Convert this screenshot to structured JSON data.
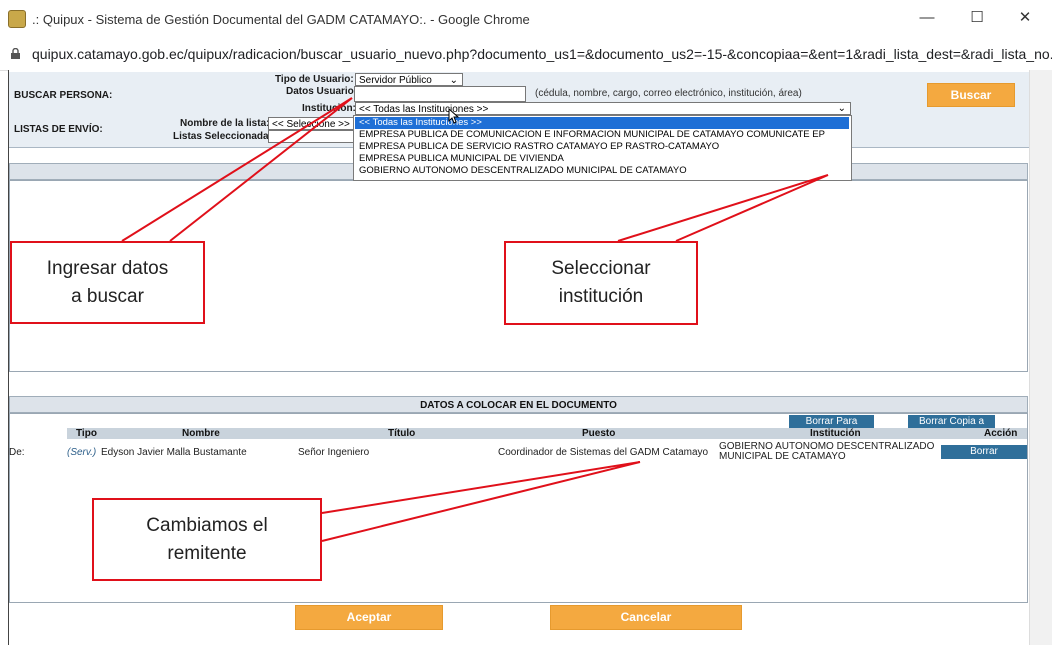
{
  "window": {
    "title": ".: Quipux - Sistema de Gestión Documental del GADM CATAMAYO:. - Google Chrome",
    "minimize": "—",
    "maximize": "☐",
    "close": "✕"
  },
  "address": {
    "url": "quipux.catamayo.gob.ec/quipux/radicacion/buscar_usuario_nuevo.php?documento_us1=&documento_us2=-15-&concopiaa=&ent=1&radi_lista_dest=&radi_lista_no..."
  },
  "search": {
    "section_label": "BUSCAR PERSONA:",
    "lists_label": "LISTAS DE ENVÍO:",
    "tipo_usuario_label": "Tipo de Usuario:",
    "tipo_usuario_value": "Servidor Público",
    "datos_usuario_label": "Datos Usuario:",
    "datos_usuario_value": "",
    "datos_hint": "(cédula, nombre, cargo, correo electrónico, institución, área)",
    "institucion_label": "Institución:",
    "institucion_value": "<< Todas las Instituciones >>",
    "lista_label": "Nombre de la lista:",
    "lista_value": "<< Seleccione >>",
    "seleccionadas_label": "Listas Seleccionadas:",
    "buscar": "Buscar"
  },
  "dropdown": {
    "options": [
      "<< Todas las Instituciones >>",
      "EMPRESA PUBLICA DE COMUNICACION E INFORMACION MUNICIPAL DE CATAMAYO COMUNICATE EP",
      "EMPRESA PUBLICA DE SERVICIO RASTRO CATAMAYO EP RASTRO-CATAMAYO",
      "EMPRESA PUBLICA MUNICIPAL DE VIVIENDA",
      "GOBIERNO AUTONOMO DESCENTRALIZADO MUNICIPAL DE CATAMAYO"
    ]
  },
  "datos": {
    "title": "DATOS A COLOCAR EN EL DOCUMENTO",
    "borrar_para": "Borrar Para",
    "borrar_copia": "Borrar Copia a",
    "columns": {
      "tipo": "Tipo",
      "nombre": "Nombre",
      "titulo": "Título",
      "puesto": "Puesto",
      "institucion": "Institución",
      "accion": "Acción"
    },
    "row": {
      "de": "De:",
      "tipo": "(Serv.)",
      "nombre": "Edyson Javier Malla Bustamante",
      "titulo": "Señor Ingeniero",
      "puesto": "Coordinador de Sistemas del GADM Catamayo",
      "institucion_line1": "GOBIERNO AUTONOMO DESCENTRALIZADO",
      "institucion_line2": "MUNICIPAL DE CATAMAYO",
      "accion": "Borrar"
    }
  },
  "footer": {
    "aceptar": "Aceptar",
    "cancelar": "Cancelar"
  },
  "callouts": {
    "ingresar_line1": "Ingresar datos",
    "ingresar_line2": "a buscar",
    "seleccionar_line1": "Seleccionar",
    "seleccionar_line2": "institución",
    "cambiamos_line1": "Cambiamos el",
    "cambiamos_line2": "remitente"
  },
  "colors": {
    "accent_orange": "#f4a940",
    "button_blue": "#2f6f9a",
    "callout_red": "#e0101a",
    "selection_blue": "#1e6fd6"
  }
}
